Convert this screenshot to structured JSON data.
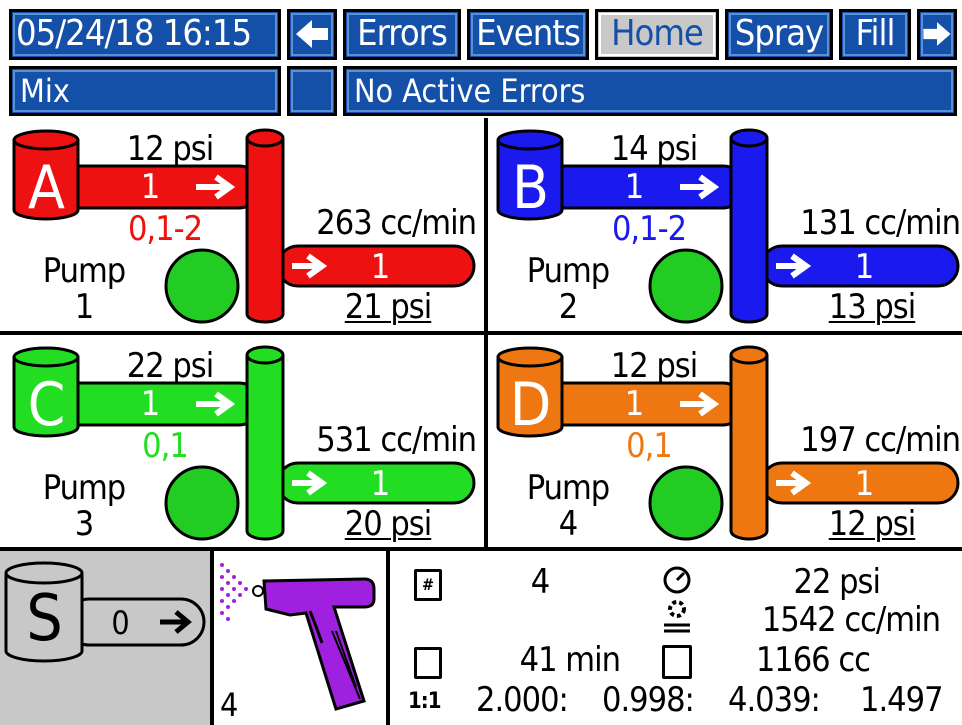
{
  "header": {
    "datetime": "05/24/18 16:15",
    "tabs": [
      "Errors",
      "Events",
      "Home",
      "Spray",
      "Fill"
    ],
    "active_tab": "Home",
    "mode": "Mix",
    "status": "No Active Errors"
  },
  "pumps": [
    {
      "letter": "A",
      "color": "#ee1111",
      "valve_color": "#ee1111",
      "inlet_psi": "12 psi",
      "inlet_valve": "1",
      "valve_range": "0,1-2",
      "flow": "263 cc/min",
      "outlet_valve": "1",
      "outlet_psi": "21 psi",
      "pump_label": "Pump",
      "pump_number": "1",
      "indicator_color": "#22cc22"
    },
    {
      "letter": "B",
      "color": "#1a1aee",
      "valve_color": "#1a1aee",
      "inlet_psi": "14 psi",
      "inlet_valve": "1",
      "valve_range": "0,1-2",
      "flow": "131 cc/min",
      "outlet_valve": "1",
      "outlet_psi": "13 psi",
      "pump_label": "Pump",
      "pump_number": "2",
      "indicator_color": "#22cc22"
    },
    {
      "letter": "C",
      "color": "#22dd22",
      "valve_color": "#22dd22",
      "inlet_psi": "22 psi",
      "inlet_valve": "1",
      "valve_range": "0,1",
      "flow": "531 cc/min",
      "outlet_valve": "1",
      "outlet_psi": "20 psi",
      "pump_label": "Pump",
      "pump_number": "3",
      "indicator_color": "#22cc22"
    },
    {
      "letter": "D",
      "color": "#ee7711",
      "valve_color": "#ee7711",
      "inlet_psi": "12 psi",
      "inlet_valve": "1",
      "valve_range": "0,1",
      "flow": "197 cc/min",
      "outlet_valve": "1",
      "outlet_psi": "12 psi",
      "pump_label": "Pump",
      "pump_number": "4",
      "indicator_color": "#22cc22"
    }
  ],
  "solvent": {
    "letter": "S",
    "valve": "0",
    "color": "#c8c8c8"
  },
  "gun": {
    "number": "4",
    "color": "#a020e0"
  },
  "stats": {
    "recipe": "4",
    "pressure": "22 psi",
    "flow": "1542 cc/min",
    "potlife": "41 min",
    "volume": "1166 cc",
    "ratio_label": "1:1",
    "ratios": [
      "2.000:",
      "0.998:",
      "4.039:",
      "1.497"
    ]
  }
}
